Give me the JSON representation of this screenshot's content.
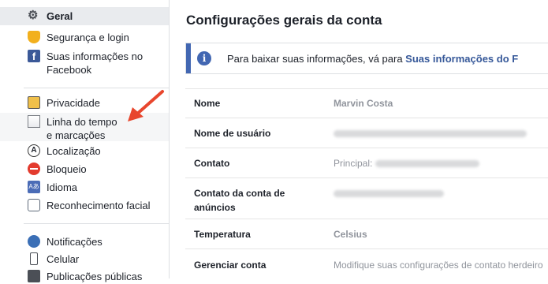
{
  "sidebar": {
    "items": [
      {
        "label": "Geral",
        "icon": "gear-icon"
      },
      {
        "label": "Segurança e login",
        "icon": "shield-icon"
      },
      {
        "label": "Suas informações no Facebook",
        "icon": "facebook-icon",
        "icon_glyph": "f"
      },
      {
        "label": "Privacidade",
        "icon": "lock-icon"
      },
      {
        "label": "Linha do tempo e marcações",
        "icon": "timeline-icon"
      },
      {
        "label": "Localização",
        "icon": "location-icon",
        "icon_glyph": "A"
      },
      {
        "label": "Bloqueio",
        "icon": "block-icon"
      },
      {
        "label": "Idioma",
        "icon": "language-icon",
        "icon_glyph": "Aあ"
      },
      {
        "label": "Reconhecimento facial",
        "icon": "face-recognition-icon"
      },
      {
        "label": "Notificações",
        "icon": "globe-icon"
      },
      {
        "label": "Celular",
        "icon": "phone-icon"
      },
      {
        "label": "Publicações públicas",
        "icon": "public-posts-icon"
      }
    ]
  },
  "main": {
    "title": "Configurações gerais da conta",
    "banner": {
      "text": "Para baixar suas informações, vá para ",
      "link": "Suas informações do F"
    },
    "rows": [
      {
        "label": "Nome",
        "value": "Marvin Costa"
      },
      {
        "label": "Nome de usuário",
        "value": ""
      },
      {
        "label": "Contato",
        "value": "Principal:"
      },
      {
        "label": "Contato da conta de anúncios",
        "value": ""
      },
      {
        "label": "Temperatura",
        "value": "Celsius"
      },
      {
        "label": "Gerenciar conta",
        "value": "Modifique suas configurações de contato herdeiro"
      }
    ]
  },
  "colors": {
    "accent": "#4267b2",
    "link": "#365899",
    "annotation_arrow": "#e8462d",
    "active_bg": "#e9ebee"
  }
}
